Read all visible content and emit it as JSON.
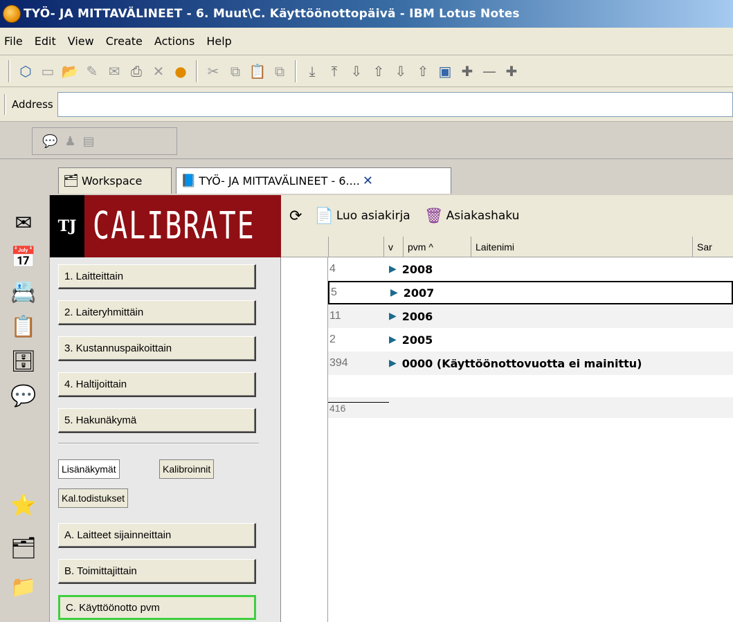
{
  "window": {
    "title": "TYÖ- JA MITTAVÄLINEET - 6. Muut\\C. Käyttöönottopäivä - IBM Lotus Notes"
  },
  "menu": [
    "File",
    "Edit",
    "View",
    "Create",
    "Actions",
    "Help"
  ],
  "address": {
    "label": "Address",
    "value": ""
  },
  "tabs": [
    {
      "label": "Workspace",
      "icon": "workspace-icon"
    },
    {
      "label": "TYÖ- JA MITTAVÄLINEET - 6....",
      "icon": "database-icon"
    }
  ],
  "logo": {
    "tj": "TJ",
    "brand": "CALIBRATE",
    "brand_color": "#900f14"
  },
  "nav": {
    "main_buttons": [
      "1. Laitteittain",
      "2. Laiteryhmittäin",
      "3. Kustannuspaikoittain",
      "4. Haltijoittain",
      "5. Hakunäkymä"
    ],
    "sub_buttons": [
      "Lisänäkymät",
      "Kalibroinnit",
      "Kal.todistukset"
    ],
    "extra_buttons": [
      "A. Laitteet sijainneittain",
      "B. Toimittajittain",
      "C. Käyttöönotto pvm"
    ],
    "active_button": "C. Käyttöönotto pvm",
    "active_color": "#3fcf3f"
  },
  "actions": {
    "create": "Luo asiakirja",
    "search": "Asiakashaku"
  },
  "columns": {
    "v": "v",
    "pvm": "pvm ^",
    "name": "Laitenimi",
    "cut": "Sar"
  },
  "rows": [
    {
      "count": "4",
      "label": "2008"
    },
    {
      "count": "5",
      "label": "2007"
    },
    {
      "count": "11",
      "label": "2006"
    },
    {
      "count": "2",
      "label": "2005"
    },
    {
      "count": "394",
      "label": "0000 (Käyttöönottovuotta ei mainittu)"
    }
  ],
  "total": "416"
}
